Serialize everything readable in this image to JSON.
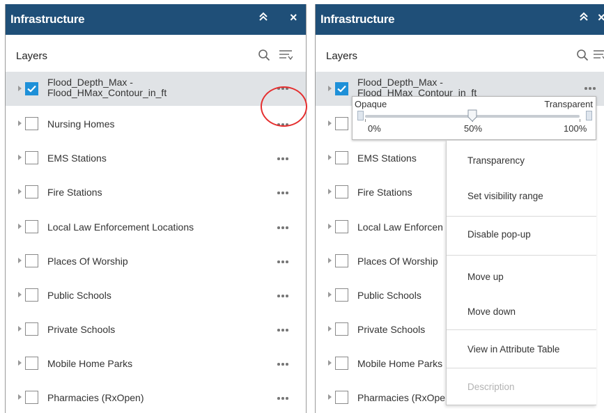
{
  "panel": {
    "title": "Infrastructure",
    "collapse_glyph": "≈",
    "close_glyph": "×",
    "layers_label": "Layers",
    "search_icon": "search-icon",
    "filter_icon": "filter-icon",
    "more_icon": "more-options-icon"
  },
  "layers": [
    {
      "name_line1": "Flood_Depth_Max -",
      "name_line2": "Flood_HMax_Contour_in_ft",
      "checked": true
    },
    {
      "name": "Nursing Homes",
      "checked": false
    },
    {
      "name": "EMS Stations",
      "checked": false
    },
    {
      "name": "Fire Stations",
      "checked": false
    },
    {
      "name": "Local Law Enforcement Locations",
      "checked": false
    },
    {
      "name": "Places Of Worship",
      "checked": false
    },
    {
      "name": "Public Schools",
      "checked": false
    },
    {
      "name": "Private Schools",
      "checked": false
    },
    {
      "name": "Mobile Home Parks",
      "checked": false
    },
    {
      "name": "Pharmacies (RxOpen)",
      "checked": false
    }
  ],
  "right_layers": {
    "row4": "Local Law Enforcen",
    "row8": "Mobile Home Parks",
    "row9": "Pharmacies (RxOpe"
  },
  "transparency_slider": {
    "left_label": "Opaque",
    "right_label": "Transparent",
    "ticks": [
      "0%",
      "50%",
      "100%"
    ],
    "value_percent": 50
  },
  "context_menu": {
    "items": [
      "Transparency",
      "Set visibility range",
      "Disable pop-up",
      "Move up",
      "Move down",
      "View in Attribute Table",
      "Description"
    ],
    "disabled": [
      "Description"
    ]
  },
  "colors": {
    "header_bg": "#1f4f78",
    "checkbox_checked": "#1e90d8",
    "highlight_ring": "#e52e2e",
    "selected_row_bg": "#e0e3e6"
  }
}
